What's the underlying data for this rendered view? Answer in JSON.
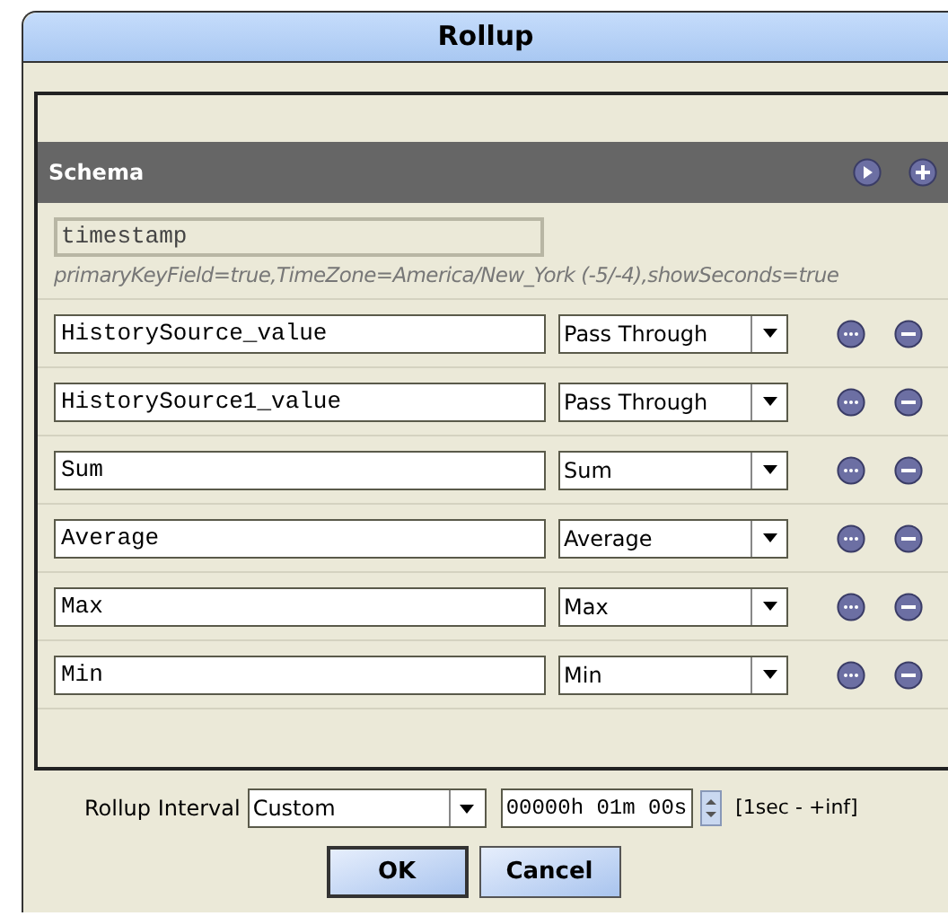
{
  "window": {
    "title": "Rollup"
  },
  "schema": {
    "title": "Schema",
    "key_field": {
      "value": "timestamp",
      "disabled": true
    },
    "key_info": "primaryKeyField=true,TimeZone=America/New_York (-5/-4),showSeconds=true",
    "rows": [
      {
        "name": "HistorySource_value",
        "function": "Pass Through"
      },
      {
        "name": "HistorySource1_value",
        "function": "Pass Through"
      },
      {
        "name": "Sum",
        "function": "Sum"
      },
      {
        "name": "Average",
        "function": "Average"
      },
      {
        "name": "Max",
        "function": "Max"
      },
      {
        "name": "Min",
        "function": "Min"
      }
    ]
  },
  "interval": {
    "label": "Rollup Interval",
    "mode": "Custom",
    "duration": "00000h 01m 00s",
    "range": "[1sec - +inf]"
  },
  "buttons": [
    {
      "label": "OK",
      "default": true
    },
    {
      "label": "Cancel",
      "default": false
    }
  ]
}
